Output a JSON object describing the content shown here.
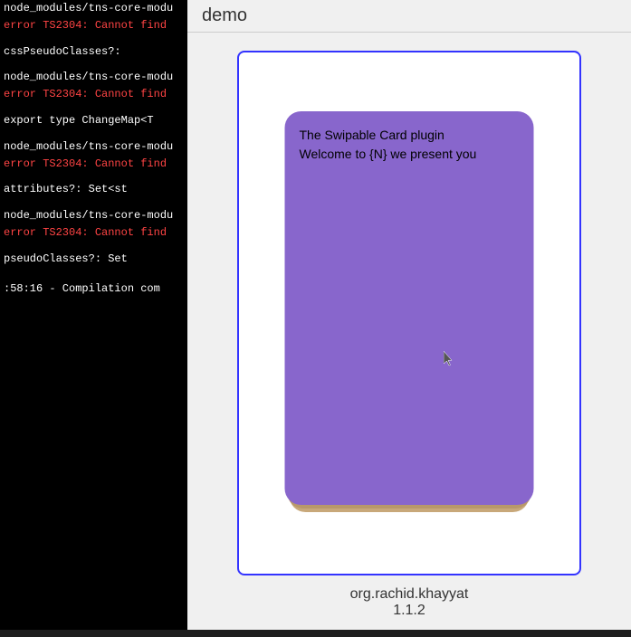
{
  "left_panel": {
    "lines": [
      {
        "text": "node_modules/tns-core-modu",
        "class": "error-path"
      },
      {
        "text": "error TS2304: Cannot find ",
        "class": "error-msg"
      },
      {
        "text": "",
        "class": "spacer"
      },
      {
        "text": "  cssPseudoClasses?: ",
        "class": "code-line"
      },
      {
        "text": "",
        "class": "spacer"
      },
      {
        "text": "node_modules/tns-core-modu",
        "class": "error-path"
      },
      {
        "text": "error TS2304: Cannot find ",
        "class": "error-msg"
      },
      {
        "text": "",
        "class": "spacer"
      },
      {
        "text": "export type ChangeMap<T",
        "class": "code-line"
      },
      {
        "text": "",
        "class": "spacer"
      },
      {
        "text": "node_modules/tns-core-modu",
        "class": "error-path"
      },
      {
        "text": "error TS2304: Cannot find ",
        "class": "error-msg"
      },
      {
        "text": "",
        "class": "spacer"
      },
      {
        "text": "  attributes?: Set<st",
        "class": "code-line"
      },
      {
        "text": "",
        "class": "spacer"
      },
      {
        "text": "node_modules/tns-core-modu",
        "class": "error-path"
      },
      {
        "text": "error TS2304: Cannot find ",
        "class": "error-msg"
      },
      {
        "text": "",
        "class": "spacer"
      },
      {
        "text": "  pseudoClasses?: Set",
        "class": "code-line"
      },
      {
        "text": "",
        "class": "spacer"
      },
      {
        "text": ":58:16 - Compilation com",
        "class": "compilation"
      }
    ]
  },
  "demo": {
    "title": "demo",
    "card": {
      "line1": "The Swipable Card plugin",
      "line2": "Welcome to {N} we present you"
    },
    "org": "org.rachid.khayyat",
    "version": "1.1.2"
  }
}
